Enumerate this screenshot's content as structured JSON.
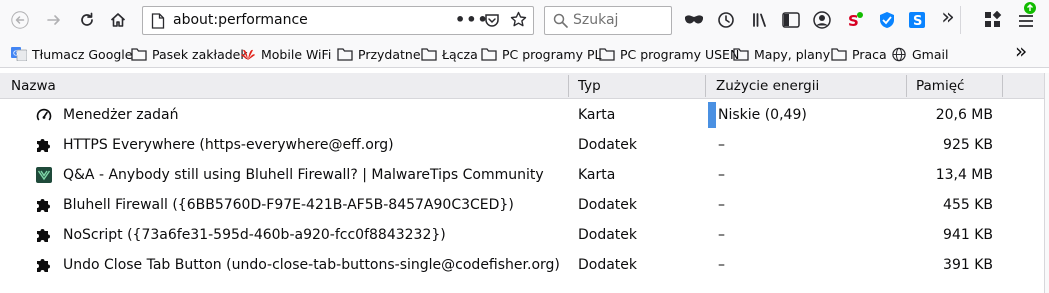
{
  "toolbar": {
    "url": "about:performance",
    "search_placeholder": "Szukaj",
    "page_actions_icon": "ellipsis-icon",
    "pocket_icon": "pocket-icon",
    "bookmark_star_icon": "star-icon",
    "overflow_label": "»"
  },
  "bookmarks": {
    "items": [
      {
        "label": "Tłumacz Google",
        "icon": "google-translate-icon"
      },
      {
        "label": "Pasek zakładek",
        "icon": "folder-icon"
      },
      {
        "label": "Mobile WiFi",
        "icon": "huawei-icon"
      },
      {
        "label": "Przydatne",
        "icon": "folder-icon"
      },
      {
        "label": "Łącza",
        "icon": "folder-icon"
      },
      {
        "label": "PC programy PL",
        "icon": "folder-icon"
      },
      {
        "label": "PC programy USEN",
        "icon": "folder-icon"
      },
      {
        "label": "Mapy, plany",
        "icon": "folder-icon"
      },
      {
        "label": "Praca",
        "icon": "folder-icon"
      },
      {
        "label": "Gmail",
        "icon": "globe-icon"
      }
    ],
    "overflow_label": "»"
  },
  "table": {
    "headers": {
      "name": "Nazwa",
      "type": "Typ",
      "energy": "Zużycie energii",
      "memory": "Pamięć"
    },
    "rows": [
      {
        "name": "Menedżer zadań",
        "type": "Karta",
        "energy": "Niskie (0,49)",
        "memory": "20,6 MB",
        "icon": "gauge-icon",
        "energy_level": 0.49
      },
      {
        "name": "HTTPS Everywhere (https-everywhere@eff.org)",
        "type": "Dodatek",
        "energy": "–",
        "memory": "925 KB",
        "icon": "puzzle-icon"
      },
      {
        "name": "Q&A - Anybody still using Bluhell Firewall? | MalwareTips Community",
        "type": "Karta",
        "energy": "–",
        "memory": "13,4 MB",
        "icon": "malwaretips-icon"
      },
      {
        "name": "Bluhell Firewall ({6BB5760D-F97E-421B-AF5B-8457A90C3CED})",
        "type": "Dodatek",
        "energy": "–",
        "memory": "455 KB",
        "icon": "puzzle-icon"
      },
      {
        "name": "NoScript ({73a6fe31-595d-460b-a920-fcc0f8843232})",
        "type": "Dodatek",
        "energy": "–",
        "memory": "941 KB",
        "icon": "puzzle-icon"
      },
      {
        "name": "Undo Close Tab Button (undo-close-tab-buttons-single@codefisher.org)",
        "type": "Dodatek",
        "energy": "–",
        "memory": "391 KB",
        "icon": "puzzle-icon"
      }
    ]
  },
  "colors": {
    "accent": "#4a90e2",
    "header_bg": "#ededf0",
    "toolbar_bg": "#f9f9fa"
  }
}
